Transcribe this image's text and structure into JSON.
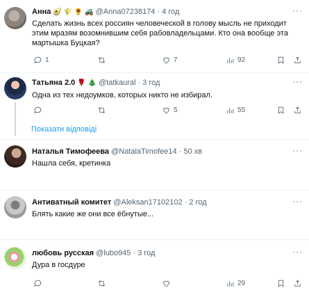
{
  "tweets": [
    {
      "name": "Анна",
      "emojis": "🥑 🌾 🌻 🚜",
      "handle": "@Anna07238174",
      "time": "4 год",
      "text_lines": [
        "Сделать жизнь всех россиян человеческой в голову мысль не приходит",
        "этим мразям возомнившим себя рабовладельцами. Кто она вообще эта",
        "мартышка Буцкая?"
      ],
      "replies": "1",
      "retweets": "",
      "likes": "7",
      "views": "92"
    },
    {
      "name": "Татьяна 2.0",
      "emojis": "🌹 🎄",
      "handle": "@tatkaural",
      "time": "3 год",
      "text_lines": [
        "Одна из тех недоумков, которых никто не избирал."
      ],
      "replies": "",
      "retweets": "",
      "likes": "5",
      "views": "55"
    },
    {
      "name": "Наталья Тимофеева",
      "emojis": "",
      "handle": "@NatalaTimofee14",
      "time": "50 хв",
      "text_lines": [
        "Нашла себя, кретинка"
      ],
      "replies": "",
      "retweets": "",
      "likes": "",
      "views": ""
    },
    {
      "name": "Антиватный комитет",
      "emojis": "",
      "handle": "@Aleksan17102102",
      "time": "2 год",
      "text_lines": [
        "Блять какие же они все ёбнутые..."
      ],
      "replies": "",
      "retweets": "",
      "likes": "",
      "views": ""
    },
    {
      "name": "любовь русская",
      "emojis": "",
      "handle": "@lubo945",
      "time": "3 год",
      "text_lines": [
        "Дура в госдуре"
      ],
      "replies": "",
      "retweets": "",
      "likes": "",
      "views": "29"
    }
  ],
  "show_replies": "Показати відповіді",
  "separator": "·",
  "more_label": "···"
}
